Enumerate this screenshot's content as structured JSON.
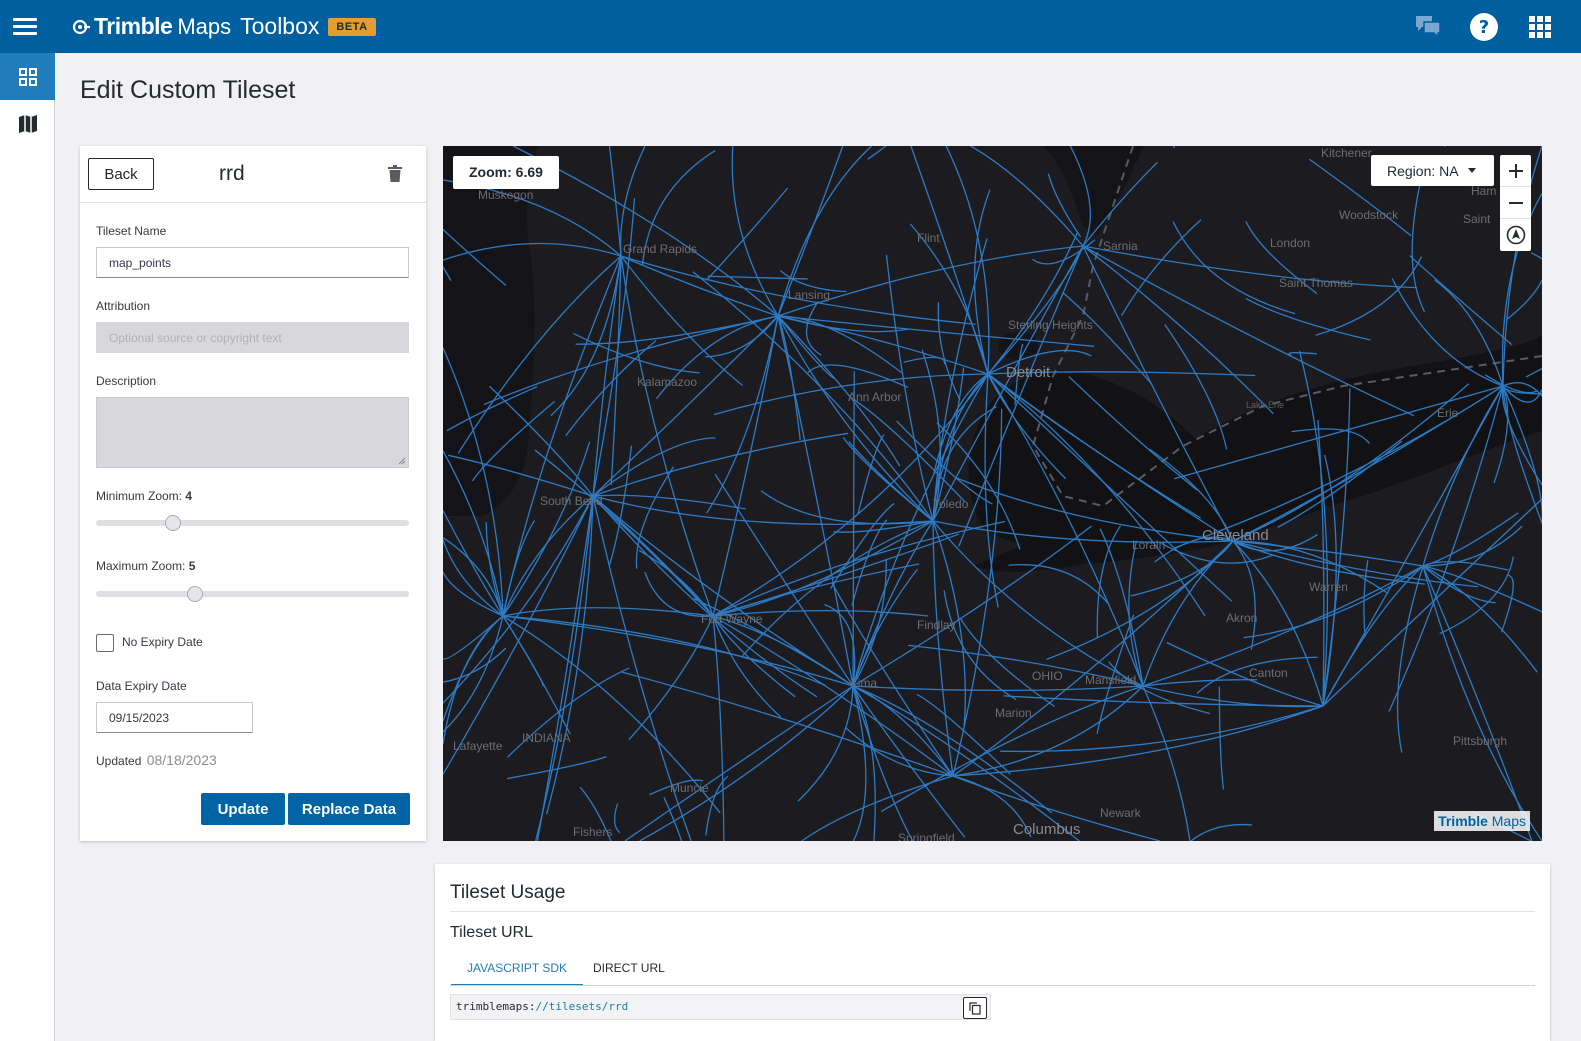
{
  "header": {
    "brand_trimble": "Trimble",
    "brand_maps": "Maps",
    "brand_product": "Toolbox",
    "beta_badge": "BETA",
    "icons": [
      "menu-icon",
      "chat-icon",
      "help-icon",
      "apps-grid-icon"
    ]
  },
  "sidebar": {
    "items": [
      {
        "icon": "dashboard-icon",
        "active": true
      },
      {
        "icon": "map-icon",
        "active": false
      }
    ]
  },
  "page": {
    "title": "Edit Custom Tileset"
  },
  "form": {
    "back_label": "Back",
    "tileset_title": "rrd",
    "tileset_name_label": "Tileset Name",
    "tileset_name_value": "map_points",
    "attribution_label": "Attribution",
    "attribution_placeholder": "Optional source or copyright text",
    "description_label": "Description",
    "min_zoom_label": "Minimum Zoom:",
    "min_zoom_value": "4",
    "max_zoom_label": "Maximum Zoom:",
    "max_zoom_value": "5",
    "no_expiry_label": "No Expiry Date",
    "no_expiry_checked": false,
    "expiry_label": "Data Expiry Date",
    "expiry_value": "09/15/2023",
    "updated_label": "Updated",
    "updated_value": "08/18/2023",
    "update_button": "Update",
    "replace_button": "Replace Data"
  },
  "map": {
    "zoom_label": "Zoom: 6.69",
    "region_label": "Region: NA",
    "logo_trimble": "Trimble",
    "logo_maps": "Maps",
    "colors": {
      "background": "#1c1b20",
      "lake": "#121214",
      "roads": "#2f86d6"
    },
    "places": [
      "Kitchener",
      "Muskegon",
      "Grand Rapids",
      "Flint",
      "Sarnia",
      "Woodstock",
      "London",
      "Saint Thomas",
      "Lansing",
      "Sterling Heights",
      "Detroit",
      "Kalamazoo",
      "Ann Arbor",
      "Lake Erie",
      "Erie",
      "South Bend",
      "Toledo",
      "Lorain",
      "Cleveland",
      "Warren",
      "Fort Wayne",
      "Findlay",
      "Akron",
      "Lima",
      "OHIO",
      "Mansfield",
      "Canton",
      "Marion",
      "INDIANA",
      "Lafayette",
      "Muncie",
      "Pittsburgh",
      "Newark",
      "Columbus",
      "Fishers",
      "Springfield",
      "Ham",
      "Saint"
    ]
  },
  "usage": {
    "title": "Tileset Usage",
    "subtitle": "Tileset URL",
    "tabs": [
      {
        "label": "JAVASCRIPT SDK",
        "active": true
      },
      {
        "label": "DIRECT URL",
        "active": false
      }
    ],
    "code_prefix": "trimblemaps:",
    "code_path": "//tilesets/rrd"
  }
}
